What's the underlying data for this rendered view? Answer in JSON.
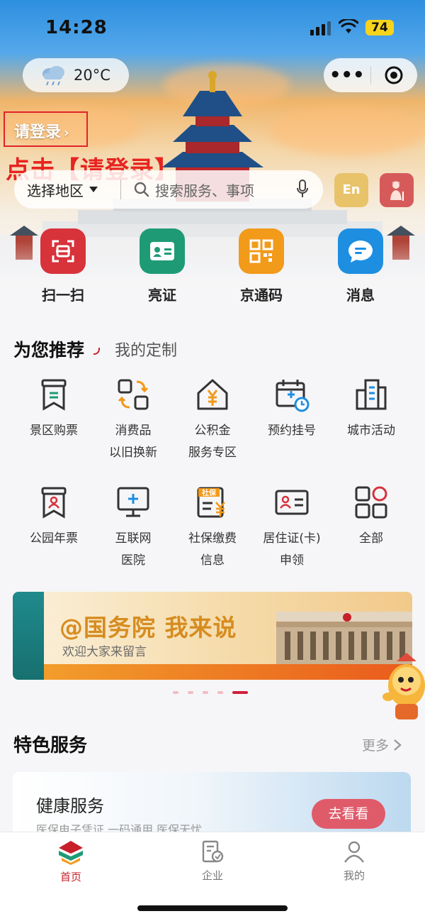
{
  "status_bar": {
    "time": "14:28",
    "battery": "74"
  },
  "weather": {
    "temperature": "20°C"
  },
  "login": {
    "label": "请登录"
  },
  "annotation": {
    "text": "点击【请登录】"
  },
  "search": {
    "region": "选择地区",
    "placeholder": "搜索服务、事项"
  },
  "lang_button": {
    "label": "En"
  },
  "quick_actions": [
    {
      "label": "扫一扫",
      "color": "#d8323b"
    },
    {
      "label": "亮证",
      "color": "#1e9b75"
    },
    {
      "label": "京通码",
      "color": "#f29a1a"
    },
    {
      "label": "消息",
      "color": "#1d8ee0"
    }
  ],
  "recommend": {
    "title": "为您推荐",
    "tab2": "我的定制",
    "items": [
      {
        "label": "景区购票",
        "icon": "ticket-icon"
      },
      {
        "label": "消费品\n以旧换新",
        "icon": "exchange-icon"
      },
      {
        "label": "公积金\n服务专区",
        "icon": "housing-fund-icon"
      },
      {
        "label": "预约挂号",
        "icon": "calendar-clock-icon"
      },
      {
        "label": "城市活动",
        "icon": "city-icon"
      },
      {
        "label": "公园年票",
        "icon": "park-ticket-icon"
      },
      {
        "label": "互联网\n医院",
        "icon": "hospital-icon"
      },
      {
        "label": "社保缴费\n信息",
        "icon": "social-security-icon"
      },
      {
        "label": "居住证(卡)\n申领",
        "icon": "id-card-icon"
      },
      {
        "label": "全部",
        "icon": "grid-all-icon"
      }
    ]
  },
  "banner": {
    "title": "@国务院 我来说",
    "subtitle": "欢迎大家来留言"
  },
  "featured": {
    "title": "特色服务",
    "more": "更多",
    "card": {
      "title": "健康服务",
      "subtitle": "医保电子凭证 一码通用 医保无忧",
      "button": "去看看"
    }
  },
  "tabs": [
    {
      "label": "首页",
      "active": true
    },
    {
      "label": "企业",
      "active": false
    },
    {
      "label": "我的",
      "active": false
    }
  ],
  "colors": {
    "accent": "#c8202a",
    "annotation": "#e8231f"
  }
}
